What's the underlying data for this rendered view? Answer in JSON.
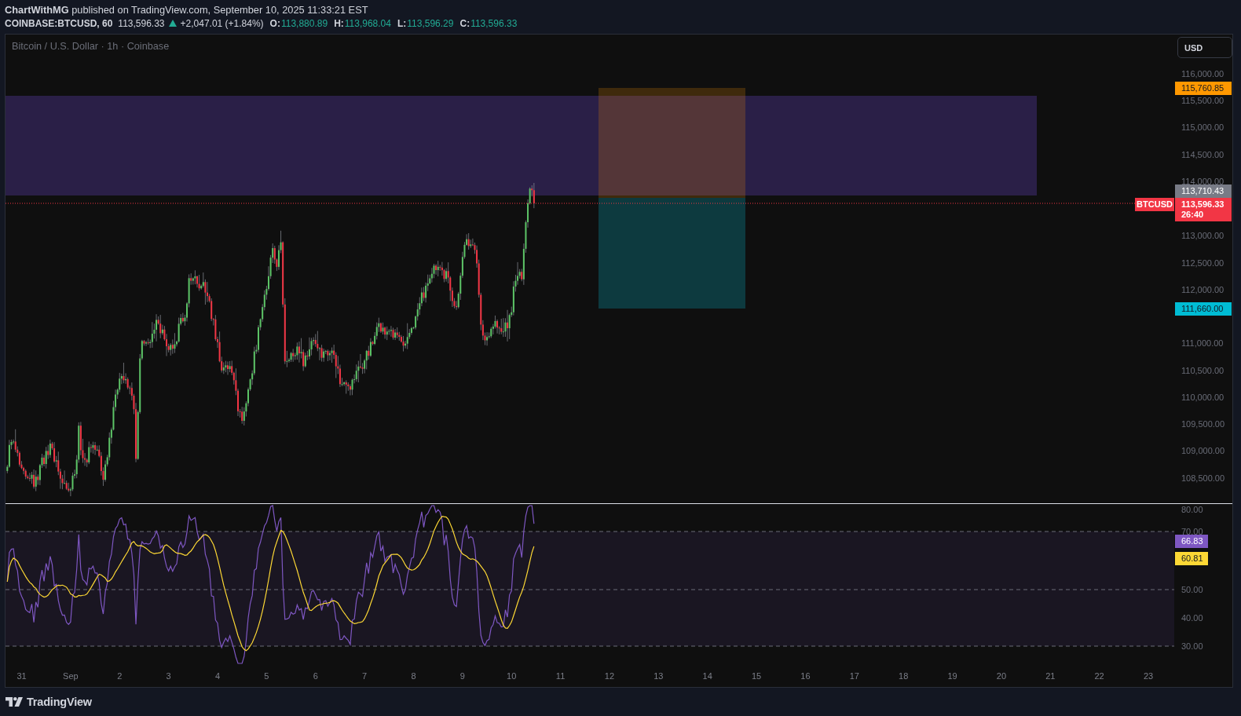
{
  "header": {
    "byline": "**ChartWithMG** published on TradingView.com, September 10, 2025 11:33:21 EST"
  },
  "quote": {
    "symbol": "COINBASE:BTCUSD, 60",
    "last": "113,596.33",
    "rising": true,
    "change": "+2,047.01 (+1.84%)",
    "ohlc": [
      {
        "label": "O:",
        "value": "113,880.89"
      },
      {
        "label": "H:",
        "value": "113,968.04"
      },
      {
        "label": "L:",
        "value": "113,596.29"
      },
      {
        "label": "C:",
        "value": "113,596.33"
      }
    ]
  },
  "chart": {
    "title": "Bitcoin / U.S. Dollar · 1h · Coinbase",
    "currency": "USD",
    "price_scale": [
      "116,000.00",
      "115,500.00",
      "115,000.00",
      "114,500.00",
      "114,000.00",
      "113,000.00",
      "112,500.00",
      "112,000.00",
      "111,000.00",
      "110,500.00",
      "110,000.00",
      "109,500.00",
      "109,000.00",
      "108,500.00"
    ],
    "price_labels": [
      {
        "text": "115,760.85",
        "color": "#ff9800"
      },
      {
        "text": "113,710.43",
        "color": "#787b86"
      },
      {
        "text": "113,596.33",
        "countdown": "26:40",
        "tag": "BTCUSD",
        "color": "#f23645"
      },
      {
        "text": "111,660.00",
        "color": "#00bcd4"
      }
    ]
  },
  "rsi": {
    "scale": [
      "80.00",
      "70.00",
      "50.00",
      "40.00",
      "30.00"
    ],
    "labels": [
      {
        "text": "66.83",
        "color": "#7e57c2"
      },
      {
        "text": "60.81",
        "color": "#fdd835"
      }
    ]
  },
  "time_scale": [
    "31",
    "Sep",
    "2",
    "3",
    "4",
    "5",
    "6",
    "7",
    "8",
    "9",
    "10",
    "11",
    "12",
    "13",
    "14",
    "15",
    "16",
    "17",
    "18",
    "19",
    "20",
    "21",
    "22",
    "23"
  ],
  "footer": {
    "brand": "TradingView"
  }
}
